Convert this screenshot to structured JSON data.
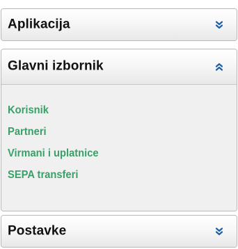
{
  "sections": [
    {
      "title": "Aplikacija",
      "expanded": false,
      "toggle_icon": "double-chevron-down-icon"
    },
    {
      "title": "Glavni izbornik",
      "expanded": true,
      "toggle_icon": "double-chevron-up-icon",
      "items": [
        {
          "label": "Korisnik"
        },
        {
          "label": "Partneri"
        },
        {
          "label": "Virmani i uplatnice"
        },
        {
          "label": "SEPA transferi"
        }
      ]
    },
    {
      "title": "Postavke",
      "expanded": false,
      "toggle_icon": "double-chevron-down-icon"
    }
  ],
  "colors": {
    "link": "#3aa06a",
    "chevron": "#1f5fa8",
    "header_text": "#111111",
    "content_bg": "#f0f0f0",
    "border": "#b8b8b8"
  }
}
